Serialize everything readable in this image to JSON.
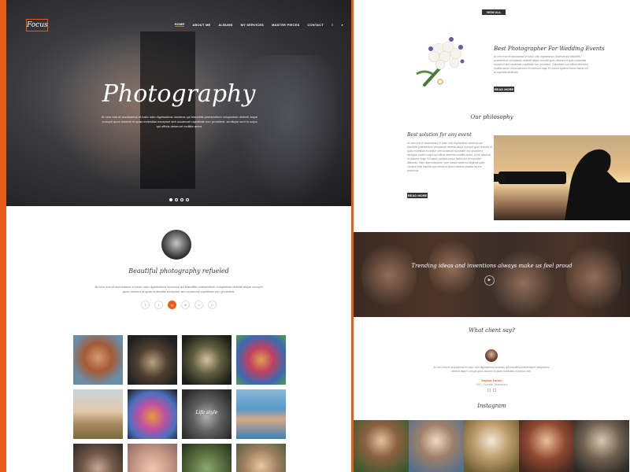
{
  "logo": "Focus",
  "nav": {
    "items": [
      "HOME",
      "ABOUT ME",
      "ALBUMS",
      "MY SERVICES",
      "MASTER PIECES",
      "CONTACT"
    ],
    "menu_icon": "≡",
    "search_icon": "⌕"
  },
  "hero": {
    "title": "Photography",
    "text": "At vero eos et accusamus et iusto odio dignissimos ducimus qui blanditiis praesentium voluptatum deleniti atque corrupti quos dolores et quas molestias excepturi sint occaecati cupiditate non provident, similique sunt in culpa qui officia deserunt mollitia animi."
  },
  "about": {
    "title": "Beautiful photography refueled",
    "text": "At vero eos et accusamus et iusto odio dignissimos ducimus qui blanditiis praesentium voluptatum deleniti atque corrupti quos dolores et quas molestias excepturi sint occaecati cupiditate non provident.",
    "socials": [
      "f",
      "t",
      "g",
      "in",
      "v",
      "p"
    ]
  },
  "gallery": {
    "caption": "Life style"
  },
  "right": {
    "view_all": "VIEW ALL WORK",
    "wedding": {
      "title": "Best Photographer For Wedding Events",
      "text": "At vero eos et accusamus et iusto odio dignissimos ducimus qui blanditiis praesentium voluptatum deleniti atque corrupti quos dolores et quas molestias excepturi sint occaecati cupiditate non provident. Cupiditate non officia deserunt mollitia animi, id est laborum et dolorum fuga. Et harum quidem rerum facilis est et expedita distinctio.",
      "button": "READ MORE"
    },
    "philosophy": {
      "title": "Our philosophy",
      "subtitle": "Best solution for any event",
      "text": "At vero eos et accusamus et iusto odio dignissimos ducimus qui blanditiis praesentium voluptatum deleniti atque corrupti quos dolores et quas molestias excepturi sint occaecati cupiditate non provident, similique sunt in culpa qui officia deserunt mollitia animi, id est laborum et dolorum fuga. Et harum quidem rerum facilis est et expedita distinctio. Nam libero tempore, cum soluta nobis est eligendi optio cumque nihil impedit quo minus id quod maxime placeat facere possimus.",
      "button": "READ MORE"
    },
    "banner_text": "Trending ideas and inventions always make us feel proud",
    "client": {
      "title": "What client say?",
      "quote": "At vero eos et accusamus et iusto odio dignissimos ducimus qui blanditiis praesentium voluptatum deleniti atque corrupti quos dolores et quas molestias excepturi sint.",
      "name": "Sophia Turner",
      "role": "CEO, Founder, Brainstorm"
    },
    "instagram_title": "Instagram"
  },
  "colors": {
    "accent": "#e65c1a",
    "dark": "#333333"
  }
}
